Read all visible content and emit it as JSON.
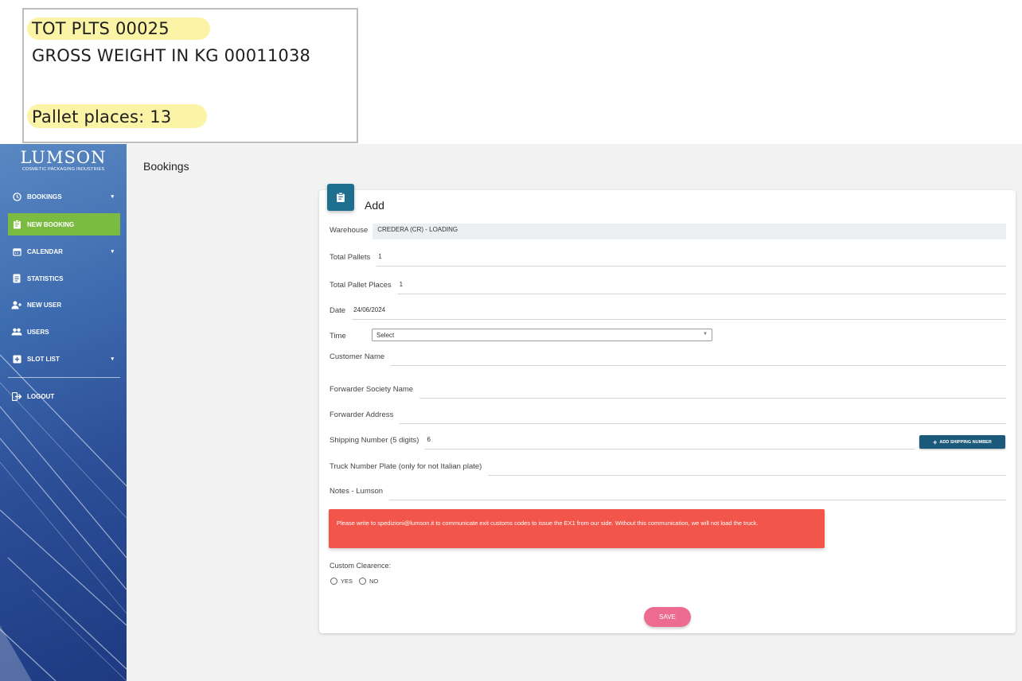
{
  "snippet": {
    "line1": "TOT PLTS 00025",
    "line2": "GROSS WEIGHT IN KG 00011038",
    "line3": "Pallet places: 13",
    "highlight_color": "#fbf3a6"
  },
  "brand": {
    "name": "LUMSON",
    "tagline": "COSMETIC PACKAGING INDUSTRIES"
  },
  "sidebar": {
    "items": [
      {
        "label": "BOOKINGS",
        "icon": "clock-icon",
        "has_chevron": true
      },
      {
        "label": "NEW BOOKING",
        "icon": "clipboard-icon",
        "active": true
      },
      {
        "label": "CALENDAR",
        "icon": "calendar-icon",
        "has_chevron": true
      },
      {
        "label": "STATISTICS",
        "icon": "document-icon"
      },
      {
        "label": "NEW USER",
        "icon": "add-user-icon"
      },
      {
        "label": "USERS",
        "icon": "users-icon"
      },
      {
        "label": "SLOT LIST",
        "icon": "slot-icon",
        "has_chevron": true
      },
      {
        "label": "LOGOUT",
        "icon": "logout-icon"
      }
    ],
    "active_color": "#7bbb42"
  },
  "header": {
    "title": "Bookings"
  },
  "card": {
    "title": "Add",
    "accent_color": "#1e6f8f",
    "fields": {
      "warehouse": {
        "label": "Warehouse",
        "value": "CREDERA (CR) - LOADING"
      },
      "total_pallets": {
        "label": "Total Pallets",
        "value": "1"
      },
      "total_pallet_places": {
        "label": "Total Pallet Places",
        "value": "1"
      },
      "date": {
        "label": "Date",
        "value": "24/06/2024"
      },
      "time": {
        "label": "Time",
        "value": "Select"
      },
      "customer_name": {
        "label": "Customer Name",
        "value": ""
      },
      "forwarder_society": {
        "label": "Forwarder Society Name",
        "value": ""
      },
      "forwarder_address": {
        "label": "Forwarder Address",
        "value": ""
      },
      "shipping_number": {
        "label": "Shipping Number (5 digits)",
        "value": "6"
      },
      "truck_plate": {
        "label": "Truck Number Plate (only for not Italian plate)",
        "value": ""
      },
      "notes": {
        "label": "Notes - Lumson",
        "value": ""
      }
    },
    "add_shipping_button": "ADD SHIPPING NUMBER",
    "alert": {
      "text": "Please write to spedizioni@lumson.it to communicate exit customs codes to issue the EX1 from our side. Without this communication, we will not load the truck.",
      "color": "#f2554a"
    },
    "custom_clearence": {
      "label": "Custom Clearence:",
      "options": [
        "YES",
        "NO"
      ]
    },
    "save_button": "SAVE",
    "save_color": "#ec6b8f"
  }
}
